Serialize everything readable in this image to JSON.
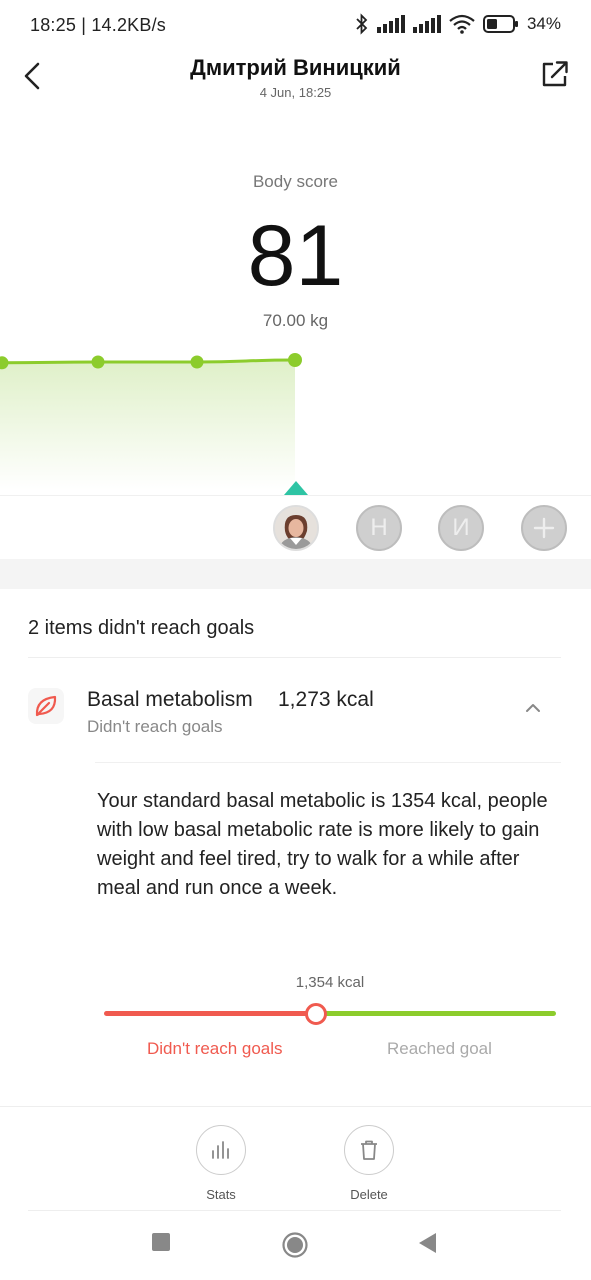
{
  "status_bar": {
    "time_speed": "18:25 | 14.2KB/s",
    "battery": "34%"
  },
  "header": {
    "title": "Дмитрий Виницкий",
    "subtitle": "4 Jun, 18:25"
  },
  "score": {
    "label": "Body score",
    "value": "81",
    "weight": "70.00 kg"
  },
  "trend": {
    "points": [
      0.28,
      0.2,
      0.2,
      0.0
    ],
    "line_color": "#8ccc2c",
    "fill_color": "#e8f5d6"
  },
  "users": {
    "letter_1": "Н",
    "letter_2": "И",
    "add_symbol": "+"
  },
  "goals": {
    "heading": "2 items didn't reach goals",
    "metric": {
      "name": "Basal metabolism",
      "value": "1,273 kcal",
      "status": "Didn't reach goals",
      "description": "Your standard basal metabolic is 1354 kcal, people with low basal metabolic rate is more likely to gain weight and feel tired, try to walk for a while after meal and run once a week."
    },
    "gauge": {
      "threshold_label": "1,354 kcal",
      "position": 0.47,
      "low_label": "Didn't reach goals",
      "high_label": "Reached goal",
      "low_color": "#f05a4f",
      "high_color": "#8ccc2c"
    }
  },
  "toolbar": {
    "stats_label": "Stats",
    "delete_label": "Delete"
  },
  "colors": {
    "accent_teal": "#2ec4a4",
    "red": "#f05a4f",
    "green": "#8ccc2c"
  }
}
